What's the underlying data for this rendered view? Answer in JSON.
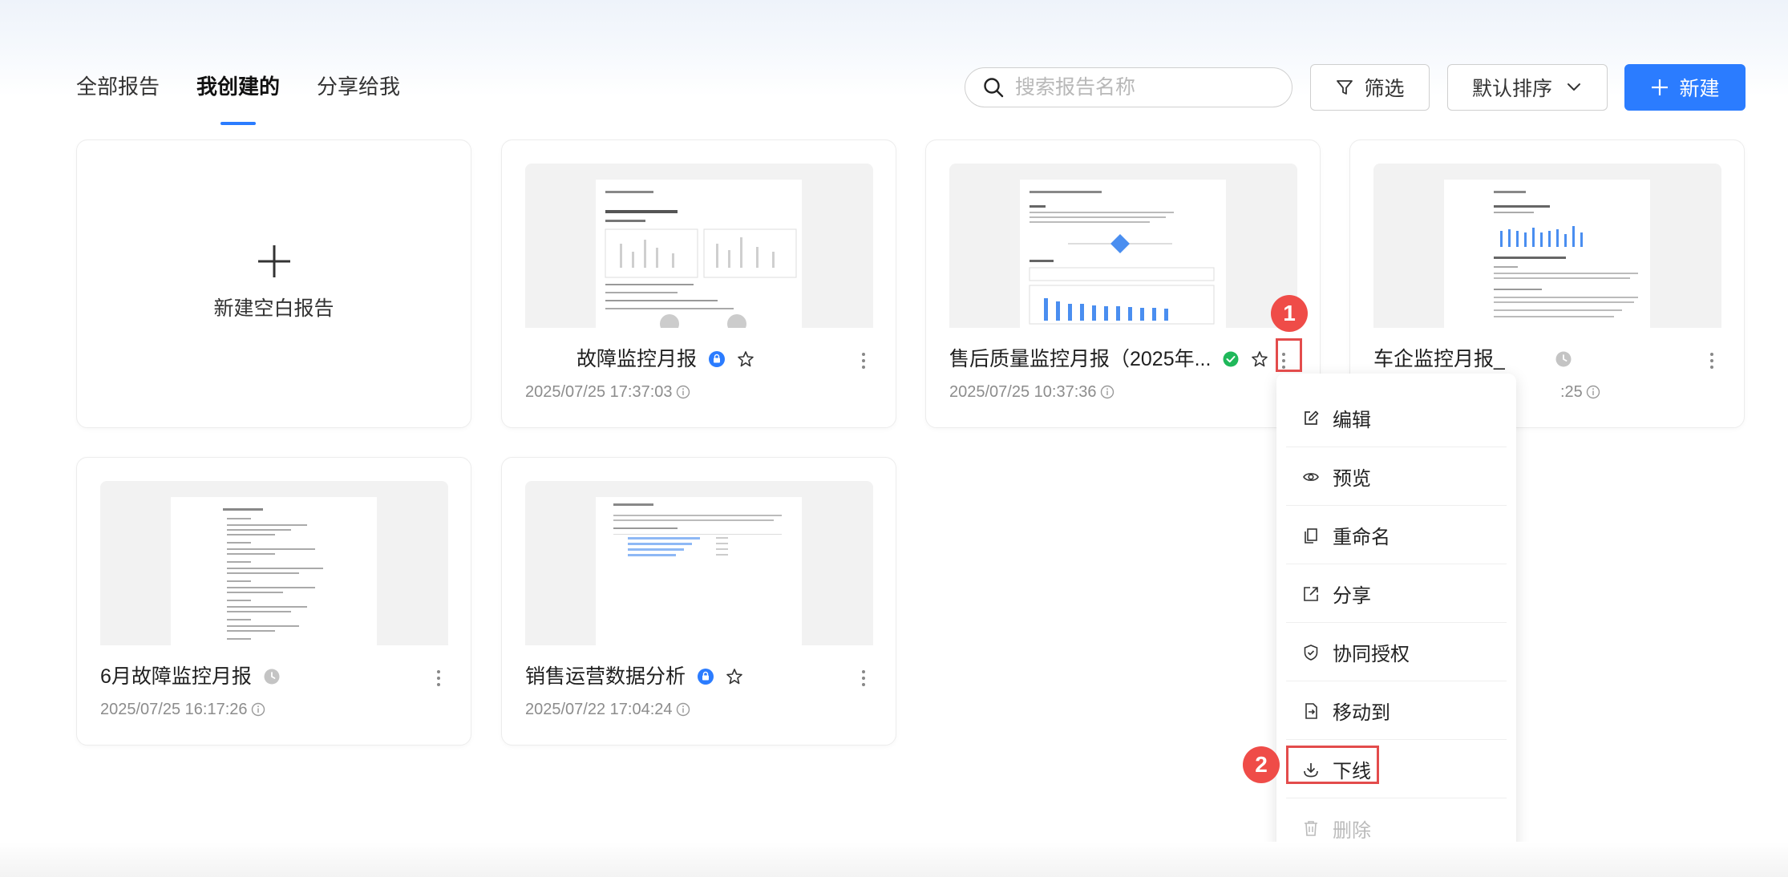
{
  "tabs": [
    {
      "label": "全部报告"
    },
    {
      "label": "我创建的",
      "active": true
    },
    {
      "label": "分享给我"
    }
  ],
  "toolbar": {
    "search_placeholder": "搜索报告名称",
    "filter_label": "筛选",
    "sort_label": "默认排序",
    "new_label": "新建",
    "accent_color": "#2b7cff"
  },
  "blank_card": {
    "label": "新建空白报告",
    "icon": "plus-icon"
  },
  "reports": [
    {
      "title": "故障监控月报",
      "status_icon": "lock-badge-icon",
      "starred_icon": "star-outline-icon",
      "date": "2025/07/25 17:37:03"
    },
    {
      "title": "售后质量监控月报（2025年...",
      "status_icon": "check-circle-icon",
      "starred_icon": "star-outline-icon",
      "date": "2025/07/25 10:37:36"
    },
    {
      "title": "车企监控月报_",
      "status_icon": "clock-icon",
      "date": ":25"
    },
    {
      "title": "6月故障监控月报",
      "status_icon": "clock-icon",
      "date": "2025/07/25 16:17:26"
    },
    {
      "title": "销售运营数据分析",
      "status_icon": "lock-badge-icon",
      "starred_icon": "star-outline-icon",
      "date": "2025/07/22 17:04:24"
    }
  ],
  "context_menu": {
    "items": [
      {
        "label": "编辑",
        "icon": "edit-icon"
      },
      {
        "label": "预览",
        "icon": "eye-icon"
      },
      {
        "label": "重命名",
        "icon": "rename-icon"
      },
      {
        "label": "分享",
        "icon": "share-icon"
      },
      {
        "label": "协同授权",
        "icon": "shield-check-icon"
      },
      {
        "label": "移动到",
        "icon": "move-icon"
      },
      {
        "label": "下线",
        "icon": "download-icon"
      },
      {
        "label": "删除",
        "icon": "trash-icon",
        "disabled": true
      }
    ]
  },
  "annotations": {
    "step1": "1",
    "step2": "2",
    "color": "#ef4c48"
  }
}
